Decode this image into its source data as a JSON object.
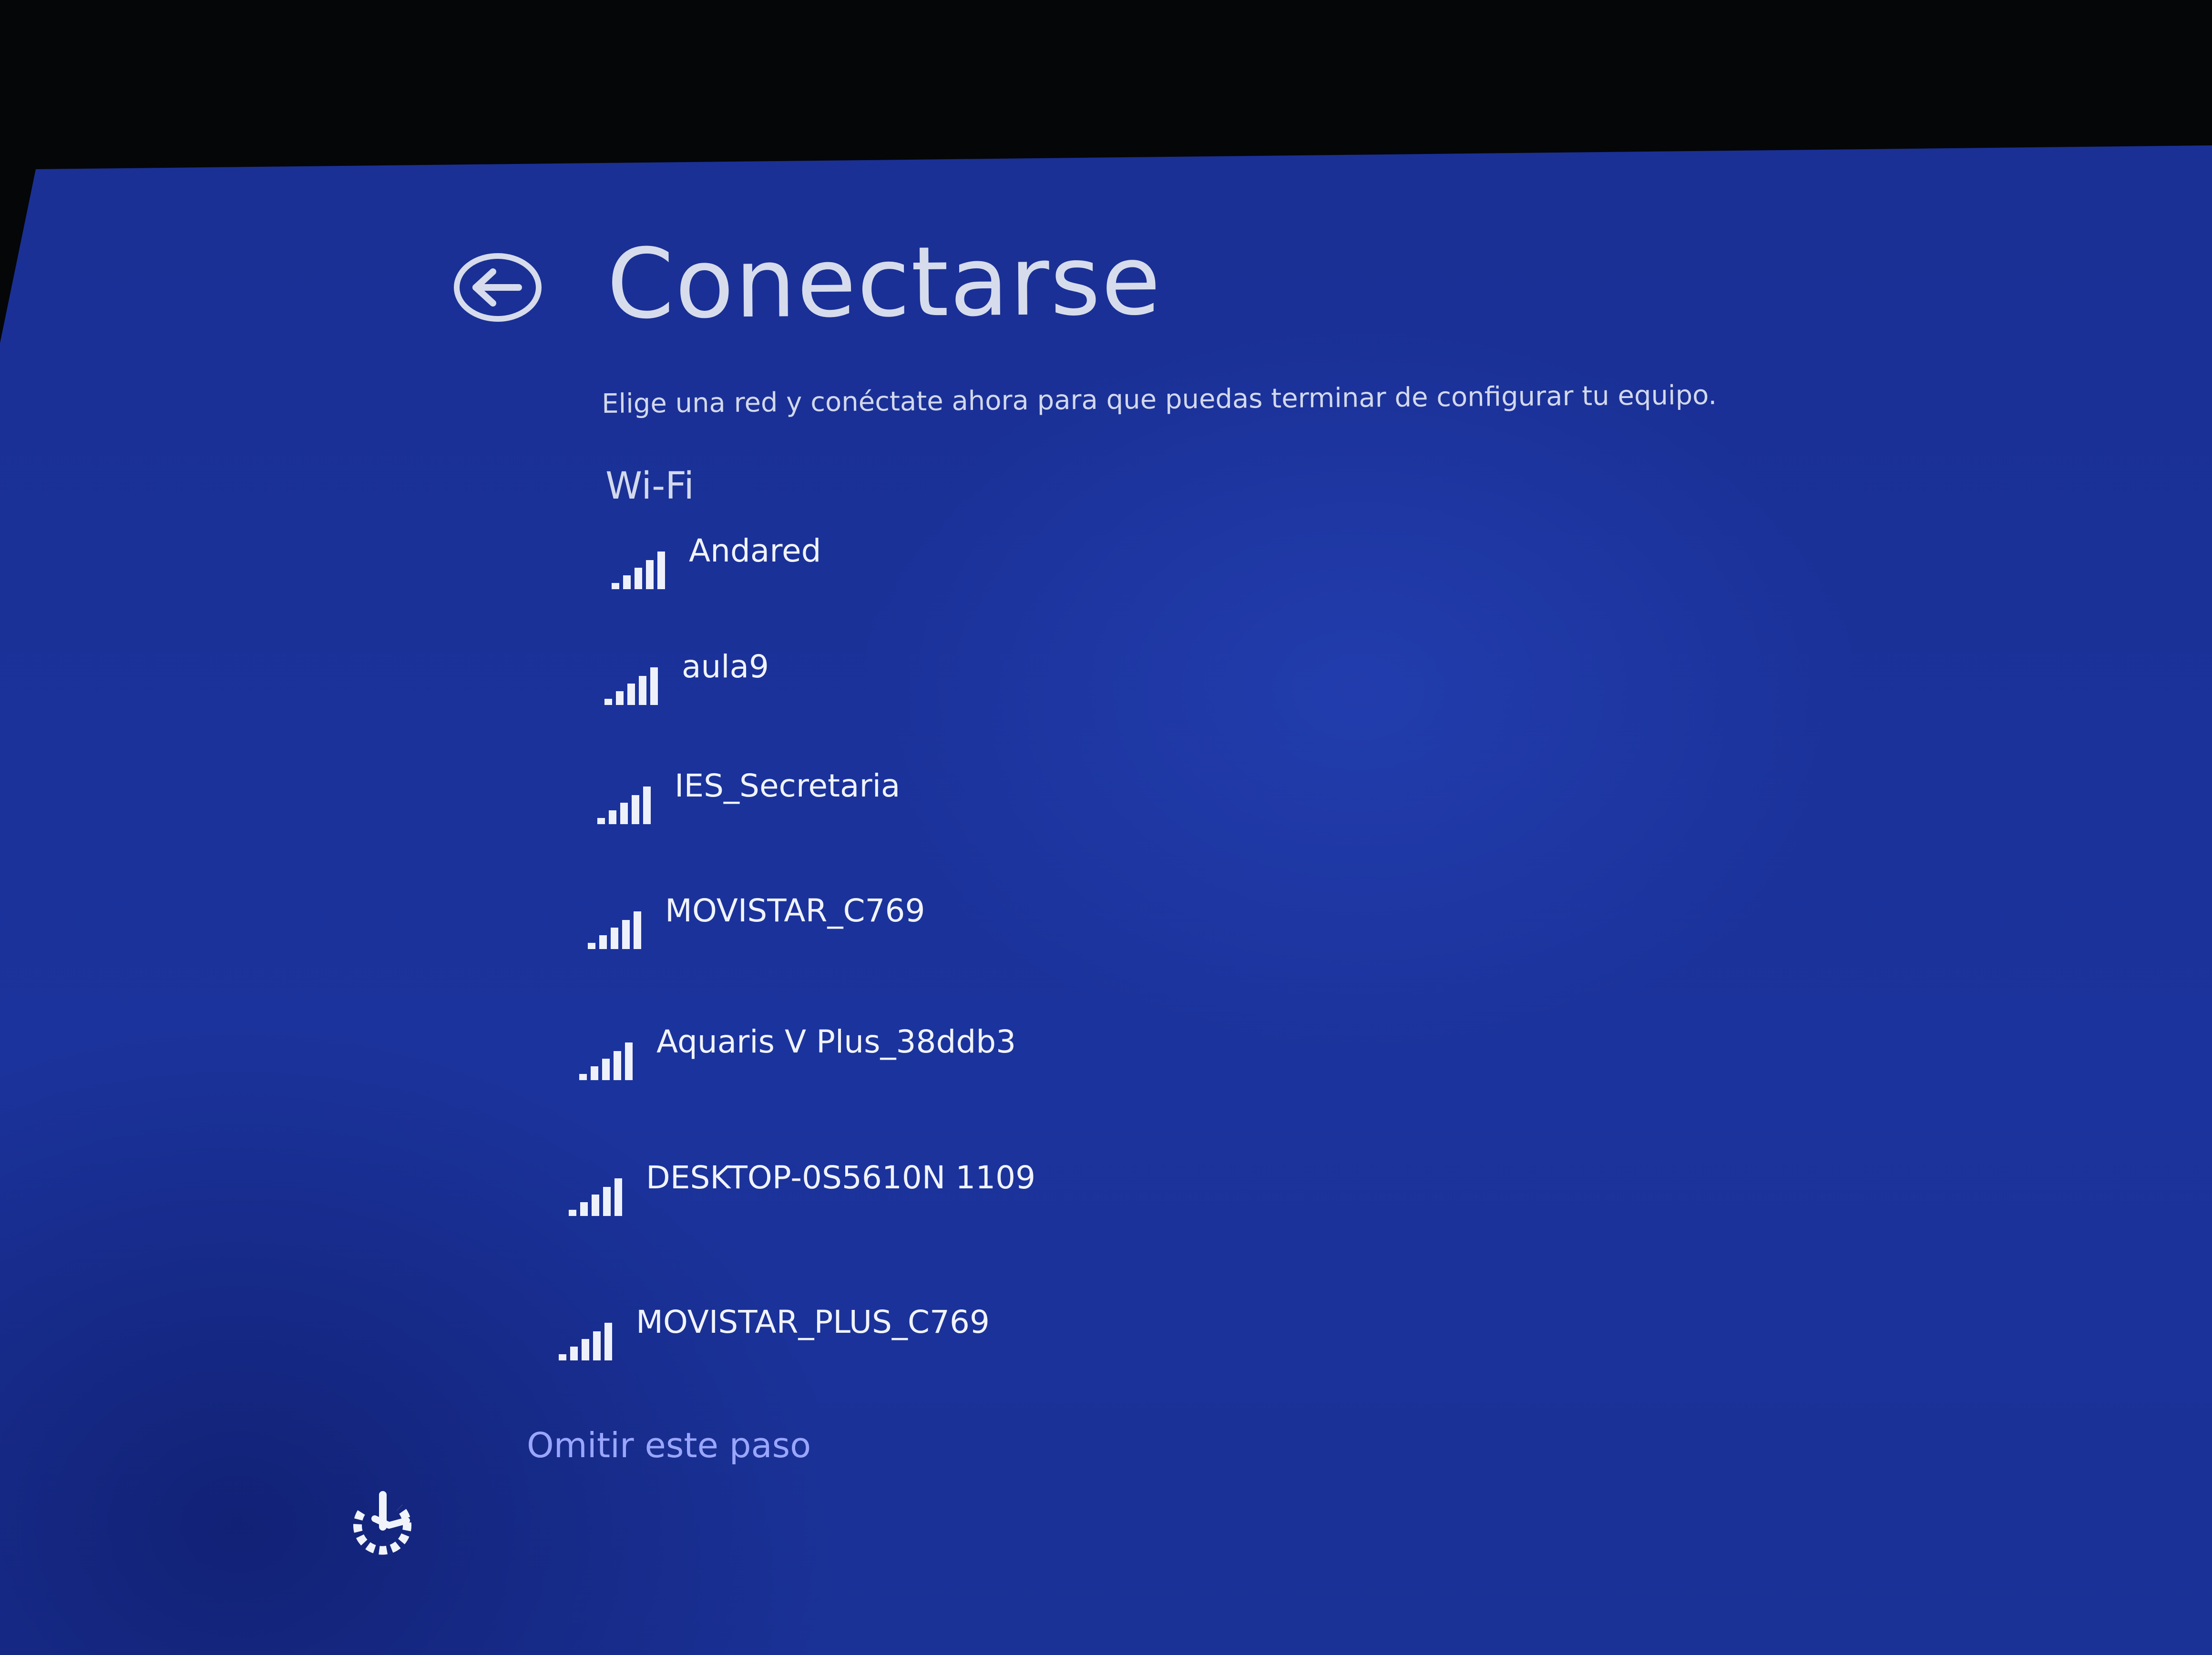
{
  "header": {
    "back_icon": "back-arrow-circle-icon",
    "title": "Conectarse"
  },
  "subtitle": "Elige una red y conéctate ahora para que puedas terminar de configurar tu equipo.",
  "section": {
    "heading": "Wi-Fi"
  },
  "networks": [
    {
      "name": "Andared",
      "icon": "wifi-signal-icon"
    },
    {
      "name": "aula9",
      "icon": "wifi-signal-icon"
    },
    {
      "name": "IES_Secretaria",
      "icon": "wifi-signal-icon"
    },
    {
      "name": "MOVISTAR_C769",
      "icon": "wifi-signal-icon"
    },
    {
      "name": "Aquaris V Plus_38ddb3",
      "icon": "wifi-signal-icon"
    },
    {
      "name": "DESKTOP-0S5610N 1109",
      "icon": "wifi-signal-icon"
    },
    {
      "name": "MOVISTAR_PLUS_C769",
      "icon": "wifi-signal-icon"
    }
  ],
  "footer": {
    "skip_label": "Omitir este paso",
    "ease_of_access_icon": "ease-of-access-icon"
  },
  "colors": {
    "background": "#1a3198",
    "text": "#e6ebf7",
    "link": "#9aa6ff"
  }
}
